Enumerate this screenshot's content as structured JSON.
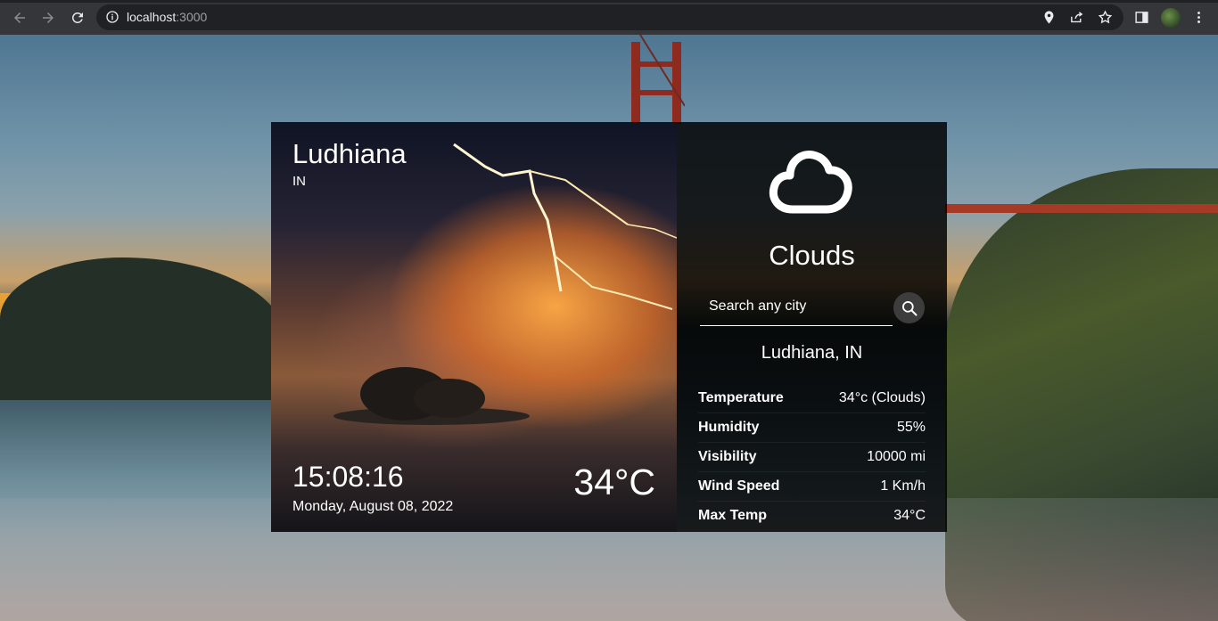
{
  "browser": {
    "url_host": "localhost",
    "url_port": ":3000"
  },
  "weather": {
    "city": "Ludhiana",
    "country": "IN",
    "time": "15:08:16",
    "date": "Monday, August 08, 2022",
    "temperature": "34°C",
    "condition": "Clouds",
    "search_placeholder": "Search any city",
    "location": "Ludhiana, IN",
    "stats": [
      {
        "label": "Temperature",
        "value": "34°c (Clouds)"
      },
      {
        "label": "Humidity",
        "value": "55%"
      },
      {
        "label": "Visibility",
        "value": "10000 mi"
      },
      {
        "label": "Wind Speed",
        "value": "1 Km/h"
      },
      {
        "label": "Max Temp",
        "value": "34°C"
      }
    ]
  }
}
